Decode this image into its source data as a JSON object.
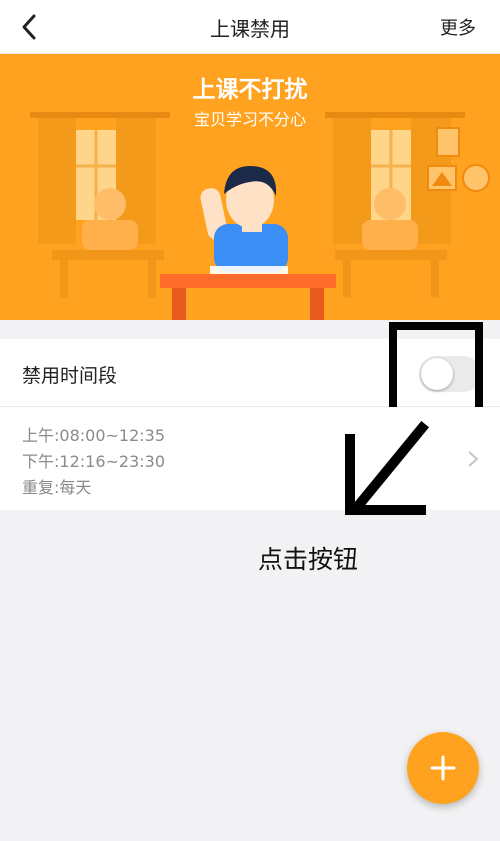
{
  "nav": {
    "title": "上课禁用",
    "more": "更多"
  },
  "banner": {
    "title": "上课不打扰",
    "subtitle": "宝贝学习不分心"
  },
  "toggle_row": {
    "label": "禁用时间段",
    "enabled": false
  },
  "schedule": {
    "lines": [
      "上午:08:00~12:35",
      "下午:12:16~23:30",
      "重复:每天"
    ]
  },
  "annotation": {
    "text": "点击按钮"
  },
  "colors": {
    "accent": "#ffa21f",
    "banner_dark": "#f08a10"
  },
  "icons": {
    "back": "chevron-left-icon",
    "chevron": "chevron-right-icon",
    "add": "plus-icon"
  }
}
